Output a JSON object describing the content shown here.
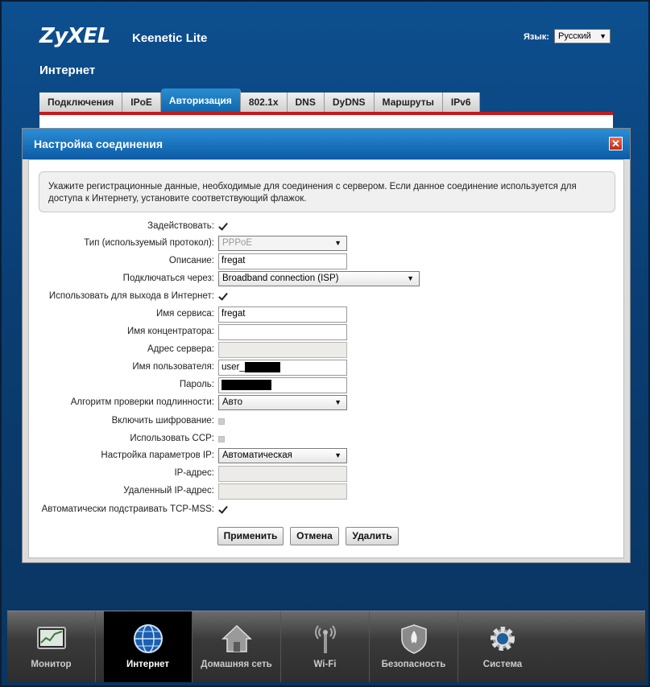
{
  "header": {
    "brand": "ZyXEL",
    "model": "Keenetic Lite",
    "language_label": "Язык:",
    "language_value": "Русский",
    "page_title": "Интернет"
  },
  "tabs": [
    {
      "label": "Подключения",
      "active": false
    },
    {
      "label": "IPoE",
      "active": false
    },
    {
      "label": "Авторизация",
      "active": true
    },
    {
      "label": "802.1x",
      "active": false
    },
    {
      "label": "DNS",
      "active": false
    },
    {
      "label": "DyDNS",
      "active": false
    },
    {
      "label": "Маршруты",
      "active": false
    },
    {
      "label": "IPv6",
      "active": false
    }
  ],
  "dialog": {
    "title": "Настройка соединения",
    "close_glyph": "✕",
    "info": "Укажите регистрационные данные, необходимые для соединения с сервером. Если данное соединение используется для доступа к Интернету, установите соответствующий флажок.",
    "fields": {
      "enable_label": "Задействовать:",
      "enable_checked": true,
      "type_label": "Тип (используемый протокол):",
      "type_value": "PPPoE",
      "description_label": "Описание:",
      "description_value": "fregat",
      "connect_via_label": "Подключаться через:",
      "connect_via_value": "Broadband connection (ISP)",
      "use_internet_label": "Использовать для выхода в Интернет:",
      "use_internet_checked": true,
      "service_label": "Имя сервиса:",
      "service_value": "fregat",
      "concentrator_label": "Имя концентратора:",
      "concentrator_value": "",
      "server_label": "Адрес сервера:",
      "server_value": "",
      "username_label": "Имя пользователя:",
      "username_value": "user_",
      "password_label": "Пароль:",
      "auth_label": "Алгоритм проверки подлинности:",
      "auth_value": "Авто",
      "encryption_label": "Включить шифрование:",
      "encryption_checked": false,
      "ccp_label": "Использовать CCP:",
      "ccp_checked": false,
      "ip_settings_label": "Настройка параметров IP:",
      "ip_settings_value": "Автоматическая",
      "ip_label": "IP-адрес:",
      "ip_value": "",
      "remote_ip_label": "Удаленный IP-адрес:",
      "remote_ip_value": "",
      "tcp_mss_label": "Автоматически подстраивать TCP-MSS:",
      "tcp_mss_checked": true
    },
    "buttons": {
      "apply": "Применить",
      "cancel": "Отмена",
      "delete": "Удалить"
    }
  },
  "bottom_nav": [
    {
      "label": "Монитор",
      "icon": "monitor-chart-icon",
      "active": false
    },
    {
      "label": "Интернет",
      "icon": "globe-icon",
      "active": true
    },
    {
      "label": "Домашняя сеть",
      "icon": "home-icon",
      "active": false
    },
    {
      "label": "Wi-Fi",
      "icon": "wifi-antenna-icon",
      "active": false
    },
    {
      "label": "Безопасность",
      "icon": "shield-icon",
      "active": false
    },
    {
      "label": "Система",
      "icon": "gear-icon",
      "active": false
    }
  ],
  "colors": {
    "accent_blue": "#1a78c2",
    "tab_underline": "#c61a1a",
    "background": "#0a3d72"
  }
}
